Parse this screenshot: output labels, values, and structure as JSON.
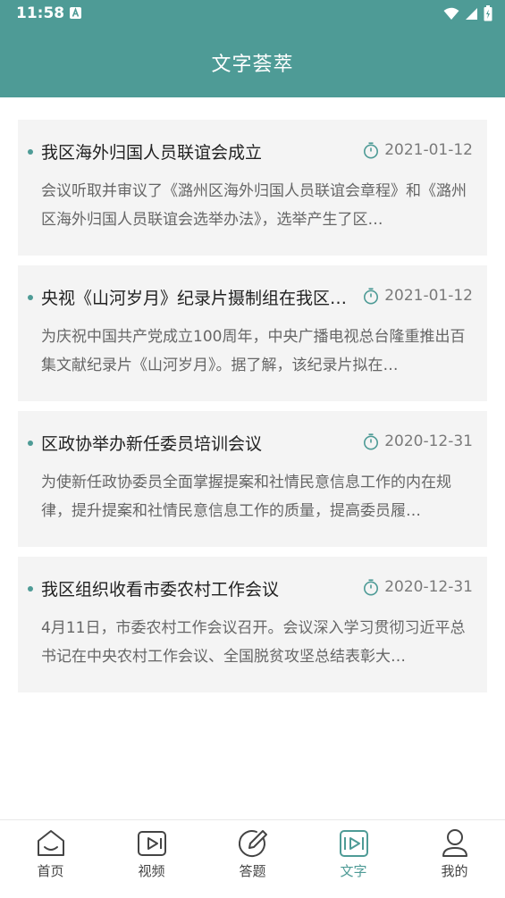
{
  "status_bar": {
    "time": "11:58"
  },
  "header": {
    "title": "文字荟萃"
  },
  "articles": [
    {
      "title": "我区海外归国人员联谊会成立",
      "date": "2021-01-12",
      "summary": "会议听取并审议了《潞州区海外归国人员联谊会章程》和《潞州区海外归国人员联谊会选举办法》，选举产生了区…"
    },
    {
      "title": "央视《山河岁月》纪录片摄制组在我区…",
      "date": "2021-01-12",
      "summary": "为庆祝中国共产党成立100周年，中央广播电视总台隆重推出百集文献纪录片《山河岁月》。据了解，该纪录片拟在…"
    },
    {
      "title": "区政协举办新任委员培训会议",
      "date": "2020-12-31",
      "summary": "为使新任政协委员全面掌握提案和社情民意信息工作的内在规律，提升提案和社情民意信息工作的质量，提高委员履…"
    },
    {
      "title": "我区组织收看市委农村工作会议",
      "date": "2020-12-31",
      "summary": "4月11日，市委农村工作会议召开。会议深入学习贯彻习近平总书记在中央农村工作会议、全国脱贫攻坚总结表彰大…"
    }
  ],
  "tabbar": {
    "items": [
      {
        "label": "首页",
        "icon": "home-icon"
      },
      {
        "label": "视频",
        "icon": "video-icon"
      },
      {
        "label": "答题",
        "icon": "pencil-icon"
      },
      {
        "label": "文字",
        "icon": "text-icon",
        "active": true
      },
      {
        "label": "我的",
        "icon": "profile-icon"
      }
    ]
  },
  "colors": {
    "accent": "#4e9b96",
    "card_bg": "#f4f4f4"
  }
}
